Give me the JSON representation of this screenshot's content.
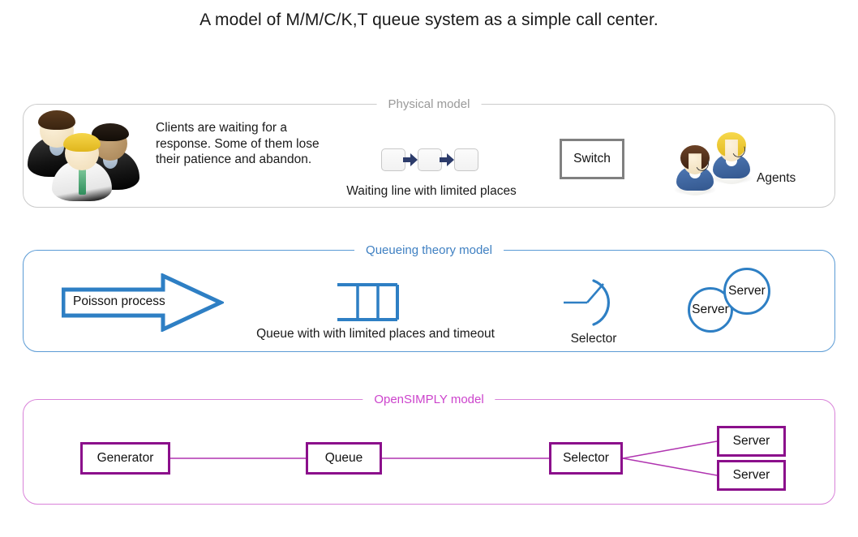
{
  "page": {
    "title": "A model of M/M/C/K,T queue system as a simple call center."
  },
  "panels": {
    "physical": {
      "legend": "Physical model",
      "border_color": "#cbcbcb",
      "legend_color": "#999999",
      "clients_text": "Clients are waiting for a response. Some of them lose their patience and abandon.",
      "waiting_line_caption": "Waiting line with limited places",
      "switch_label": "Switch",
      "agents_label": "Agents"
    },
    "queueing": {
      "legend": "Queueing theory model",
      "border_color": "#5b9bd5",
      "legend_color": "#3f80c2",
      "arrow_label": "Poisson process",
      "queue_caption": "Queue with with limited places and timeout",
      "selector_caption": "Selector",
      "server_back_label": "Server",
      "server_front_label": "Server"
    },
    "opensimply": {
      "legend": "OpenSIMPLY model",
      "border_color": "#d982d9",
      "legend_color": "#cc44cc",
      "nodes": {
        "generator": "Generator",
        "queue": "Queue",
        "selector": "Selector",
        "server_top": "Server",
        "server_bottom": "Server"
      }
    }
  }
}
